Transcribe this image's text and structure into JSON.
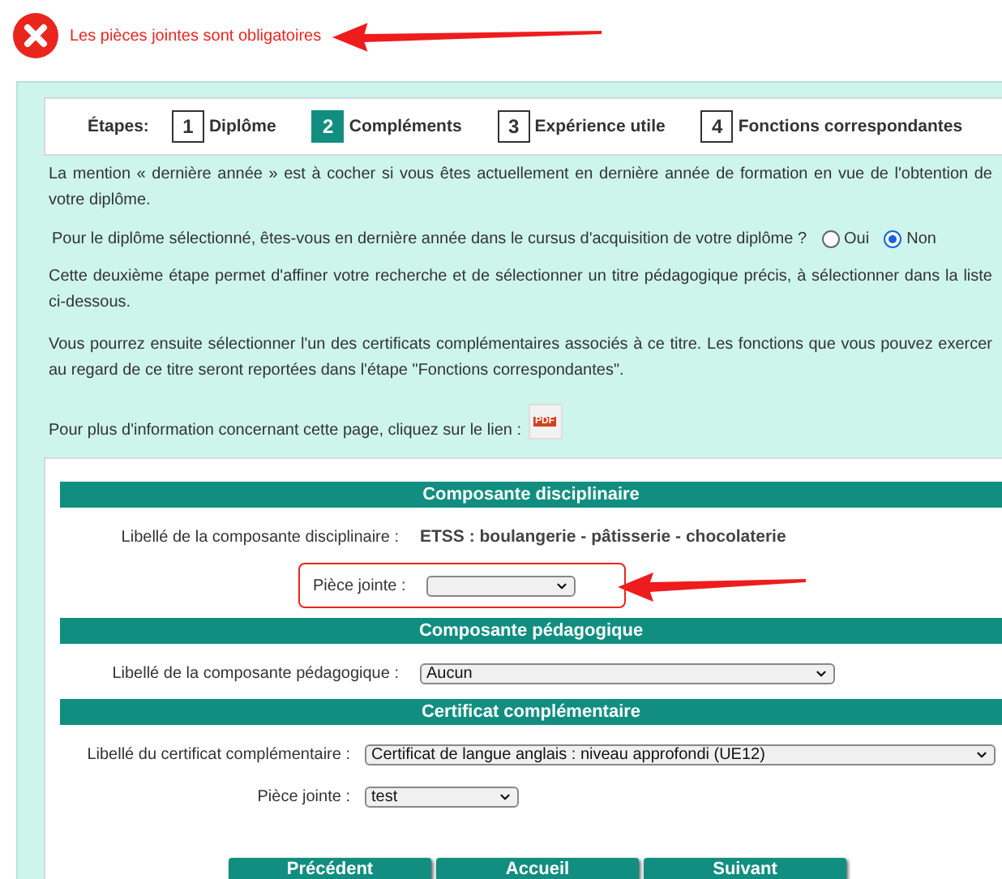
{
  "error": {
    "message": "Les pièces jointes sont obligatoires"
  },
  "steps": {
    "label": "Étapes:",
    "items": [
      {
        "number": "1",
        "label": "Diplôme",
        "selected": false
      },
      {
        "number": "2",
        "label": "Compléments",
        "selected": true
      },
      {
        "number": "3",
        "label": "Expérience utile",
        "selected": false
      },
      {
        "number": "4",
        "label": "Fonctions correspondantes",
        "selected": false
      }
    ]
  },
  "intro": "La mention « dernière année » est à cocher si vous êtes actuellement en dernière année de formation en vue de l'obtention de votre diplôme.",
  "question": {
    "text": "Pour le diplôme sélectionné, êtes-vous en dernière année dans le cursus d'acquisition de votre diplôme ?",
    "options": [
      {
        "label": "Oui",
        "selected": false
      },
      {
        "label": "Non",
        "selected": true
      }
    ]
  },
  "paragraphs": [
    "Cette deuxième étape permet d'affiner votre recherche et de sélectionner un titre pédagogique précis, à sélectionner dans la liste ci-dessous.",
    "Vous pourrez ensuite sélectionner l'un des certificats complémentaires associés à ce titre. Les fonctions que vous pouvez exercer au regard de ce titre seront reportées dans l'étape \"Fonctions correspondantes\"."
  ],
  "pdf_link": {
    "text": "Pour plus d'information concernant cette page, cliquez sur le lien :",
    "icon_label": "PDF"
  },
  "sections": [
    {
      "title": "Composante disciplinaire",
      "fields": [
        {
          "kind": "text",
          "label": "Libellé de la composante disciplinaire :",
          "value": "ETSS : boulangerie - pâtisserie - chocolaterie",
          "highlighted": false
        },
        {
          "kind": "select",
          "label": "Pièce jointe :",
          "highlighted": true
        }
      ]
    },
    {
      "title": "Composante pédagogique",
      "fields": [
        {
          "kind": "select",
          "label": "Libellé de la composante pédagogique :",
          "value": "Aucun",
          "highlighted": false
        }
      ]
    },
    {
      "title": "Certificat complémentaire",
      "fields": [
        {
          "kind": "select",
          "label": "Libellé du certificat complémentaire :",
          "value": "Certificat de langue anglais : niveau approfondi (UE12)",
          "highlighted": false
        },
        {
          "kind": "select",
          "label": "Pièce jointe :",
          "value": "test",
          "highlighted": false
        }
      ]
    }
  ],
  "buttons": [
    "Précédent",
    "Accueil",
    "Suivant"
  ]
}
